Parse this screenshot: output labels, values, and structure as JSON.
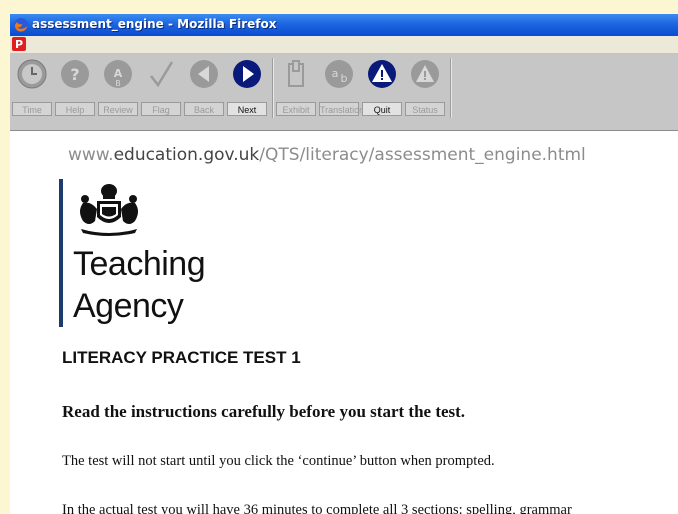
{
  "window": {
    "title": "assessment_engine - Mozilla Firefox"
  },
  "toolbar": {
    "buttons": [
      {
        "label": "Time",
        "icon": "clock-icon",
        "enabled": false
      },
      {
        "label": "Help",
        "icon": "help-icon",
        "enabled": false
      },
      {
        "label": "Review",
        "icon": "review-icon",
        "enabled": false
      },
      {
        "label": "Flag",
        "icon": "checkmark-icon",
        "enabled": false
      },
      {
        "label": "Back",
        "icon": "back-arrow-icon",
        "enabled": false
      },
      {
        "label": "Next",
        "icon": "next-arrow-icon",
        "enabled": true
      },
      {
        "label": "Exhibit",
        "icon": "exhibit-icon",
        "enabled": false
      },
      {
        "label": "Translation",
        "icon": "translation-icon",
        "enabled": false
      },
      {
        "label": "Quit",
        "icon": "warning-icon",
        "enabled": true
      },
      {
        "label": "Status",
        "icon": "status-icon",
        "enabled": false
      }
    ]
  },
  "page": {
    "url_prefix": "www.",
    "url_domain": "education.gov.uk",
    "url_path": "/QTS/literacy/assessment_engine.html",
    "logo_line1": "Teaching",
    "logo_line2": "Agency",
    "heading": "LITERACY PRACTICE TEST 1",
    "instruction": "Read the instructions carefully before you start the test.",
    "para1": "The test will not start until you click the ‘continue’ button when prompted.",
    "para2": "In the actual test you will have 36 minutes to complete all 3 sections: spelling, grammar"
  },
  "colors": {
    "titlebar": "#1d66e0",
    "toolbar": "#c6c6c6",
    "active_icon": "#0a1a7a",
    "logo_bar": "#1d3c6e",
    "background": "#fcf7d2"
  }
}
